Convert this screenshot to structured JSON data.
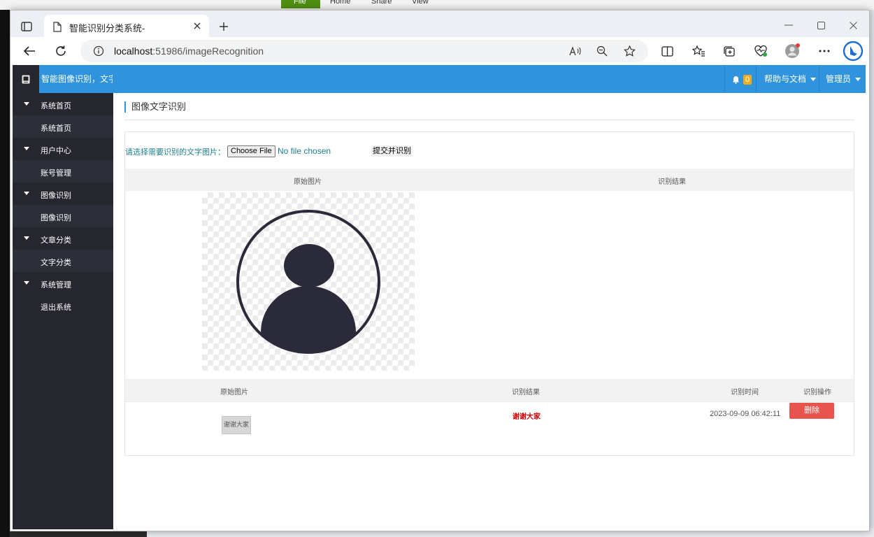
{
  "background": {
    "ribbon_tabs": [
      "File",
      "Home",
      "Share",
      "View"
    ]
  },
  "browser": {
    "tab_title": "智能识别分类系统-",
    "url_host": "localhost",
    "url_rest": ":51986/imageRecognition"
  },
  "app": {
    "brand": "智能图像识别，文字",
    "notification_count": "0",
    "help_label": "帮助与文档",
    "user_label": "管理员",
    "accent": "#2f93dd",
    "sidebar_bg": "#25262e"
  },
  "sidebar": {
    "groups": [
      {
        "label": "系统首页",
        "items": [
          "系统首页"
        ]
      },
      {
        "label": "用户中心",
        "items": [
          "账号管理"
        ]
      },
      {
        "label": "图像识别",
        "items": [
          "图像识别"
        ]
      },
      {
        "label": "文章分类",
        "items": [
          "文字分类"
        ]
      },
      {
        "label": "系统管理",
        "items": [
          "退出系统"
        ]
      }
    ]
  },
  "main": {
    "page_title": "图像文字识别",
    "upload_label": "请选择需要识别的文字图片：",
    "choose_file_label": "Choose File",
    "file_status": "No file chosen",
    "submit_label": "提交并识别",
    "preview_headers": [
      "原始图片",
      "识别结果"
    ],
    "history_headers": [
      "原始图片",
      "识别结果",
      "识别时间",
      "识别操作"
    ],
    "history_row": {
      "thumb_text": "谢谢大家",
      "result": "谢谢大家",
      "time": "2023-09-09 06:42:11",
      "delete_label": "删除"
    }
  }
}
